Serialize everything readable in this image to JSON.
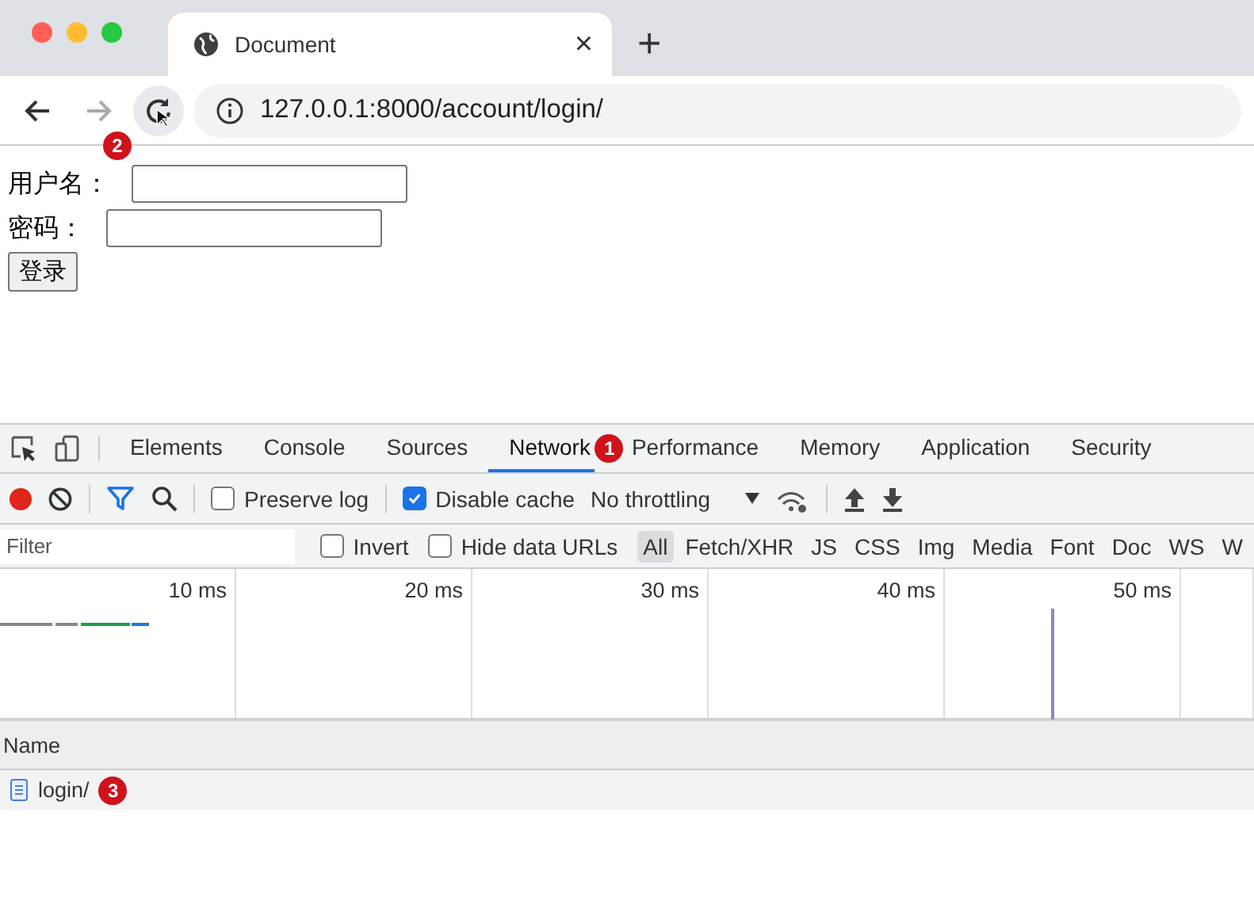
{
  "browser": {
    "tab_title": "Document",
    "close": "×",
    "new_tab": "+",
    "url": "127.0.0.1:8000/account/login/",
    "badge": "2"
  },
  "page": {
    "fields": [
      {
        "label": "用户名："
      },
      {
        "label": "密码："
      }
    ],
    "submit": "登录"
  },
  "devtools": {
    "tabs": [
      {
        "label": "Elements",
        "selected": false
      },
      {
        "label": "Console",
        "selected": false
      },
      {
        "label": "Sources",
        "selected": false
      },
      {
        "label": "Network",
        "selected": true
      },
      {
        "label": "Performance",
        "selected": false
      },
      {
        "label": "Memory",
        "selected": false
      },
      {
        "label": "Application",
        "selected": false
      },
      {
        "label": "Security",
        "selected": false
      }
    ],
    "tab_badge": "1",
    "recording": true,
    "checks": [
      {
        "label": "Preserve log",
        "checked": false
      },
      {
        "label": "Disable cache",
        "checked": true
      }
    ],
    "throttling": "No throttling",
    "filter": {
      "placeholder": "Filter",
      "checks": [
        {
          "label": "Invert",
          "checked": false
        },
        {
          "label": "Hide data URLs",
          "checked": false
        }
      ],
      "types": [
        {
          "label": "All",
          "selected": true
        },
        {
          "label": "Fetch/XHR",
          "selected": false
        },
        {
          "label": "JS",
          "selected": false
        },
        {
          "label": "CSS",
          "selected": false
        },
        {
          "label": "Img",
          "selected": false
        },
        {
          "label": "Media",
          "selected": false
        },
        {
          "label": "Font",
          "selected": false
        },
        {
          "label": "Doc",
          "selected": false
        },
        {
          "label": "WS",
          "selected": false
        },
        {
          "label": "W",
          "selected": false
        }
      ]
    },
    "timeline": {
      "ticks": [
        "10 ms",
        "20 ms",
        "30 ms",
        "40 ms",
        "50 ms"
      ]
    },
    "columns": [
      "Name"
    ],
    "rows": [
      {
        "name": "login/",
        "badge": "3"
      }
    ]
  }
}
